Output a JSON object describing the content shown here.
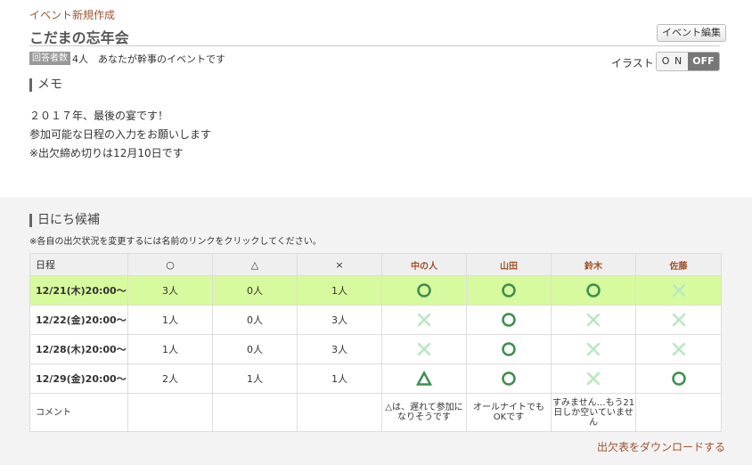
{
  "header": {
    "crumb": "イベント新規作成",
    "title": "こだまの忘年会",
    "edit_button": "イベント編集",
    "respondents_badge": "回答者数",
    "respondents_count": "4人",
    "owner_note": "あなたが幹事のイベントです"
  },
  "illustration": {
    "label": "イラスト",
    "on_label": "O N",
    "off_label": "OFF",
    "state": "OFF"
  },
  "memo": {
    "heading": "メモ",
    "lines": [
      "２０１７年、最後の宴です！",
      "参加可能な日程の入力をお願いします",
      "※出欠締め切りは12月10日です"
    ]
  },
  "schedule": {
    "heading": "日にち候補",
    "note": "※各自の出欠状況を変更するには名前のリンクをクリックしてください。",
    "columns": {
      "date": "日程",
      "ok": "○",
      "maybe": "△",
      "no": "×",
      "people": [
        "中の人",
        "山田",
        "鈴木",
        "佐藤"
      ]
    },
    "rows": [
      {
        "date": "12/21(木)20:00～",
        "ok": "3人",
        "maybe": "0人",
        "no": "1人",
        "answers": [
          "circle",
          "circle",
          "circle",
          "cross"
        ],
        "highlight": true
      },
      {
        "date": "12/22(金)20:00～",
        "ok": "1人",
        "maybe": "0人",
        "no": "3人",
        "answers": [
          "cross",
          "circle",
          "cross",
          "cross"
        ],
        "highlight": false
      },
      {
        "date": "12/28(木)20:00～",
        "ok": "1人",
        "maybe": "0人",
        "no": "3人",
        "answers": [
          "cross",
          "circle",
          "cross",
          "cross"
        ],
        "highlight": false
      },
      {
        "date": "12/29(金)20:00～",
        "ok": "2人",
        "maybe": "1人",
        "no": "1人",
        "answers": [
          "triangle",
          "circle",
          "cross",
          "circle"
        ],
        "highlight": false
      }
    ],
    "comment_label": "コメント",
    "comments": [
      "△は、遅れて参加になりそうです",
      "オールナイトでもOKです",
      "すみません…もう21日しか空いていません",
      ""
    ],
    "colors": {
      "mark_green": "#3a8f4e",
      "cross_green": "#b8e6c0",
      "highlight": "#d8fa9e"
    }
  },
  "footer": {
    "download_link": "出欠表をダウンロードする"
  }
}
